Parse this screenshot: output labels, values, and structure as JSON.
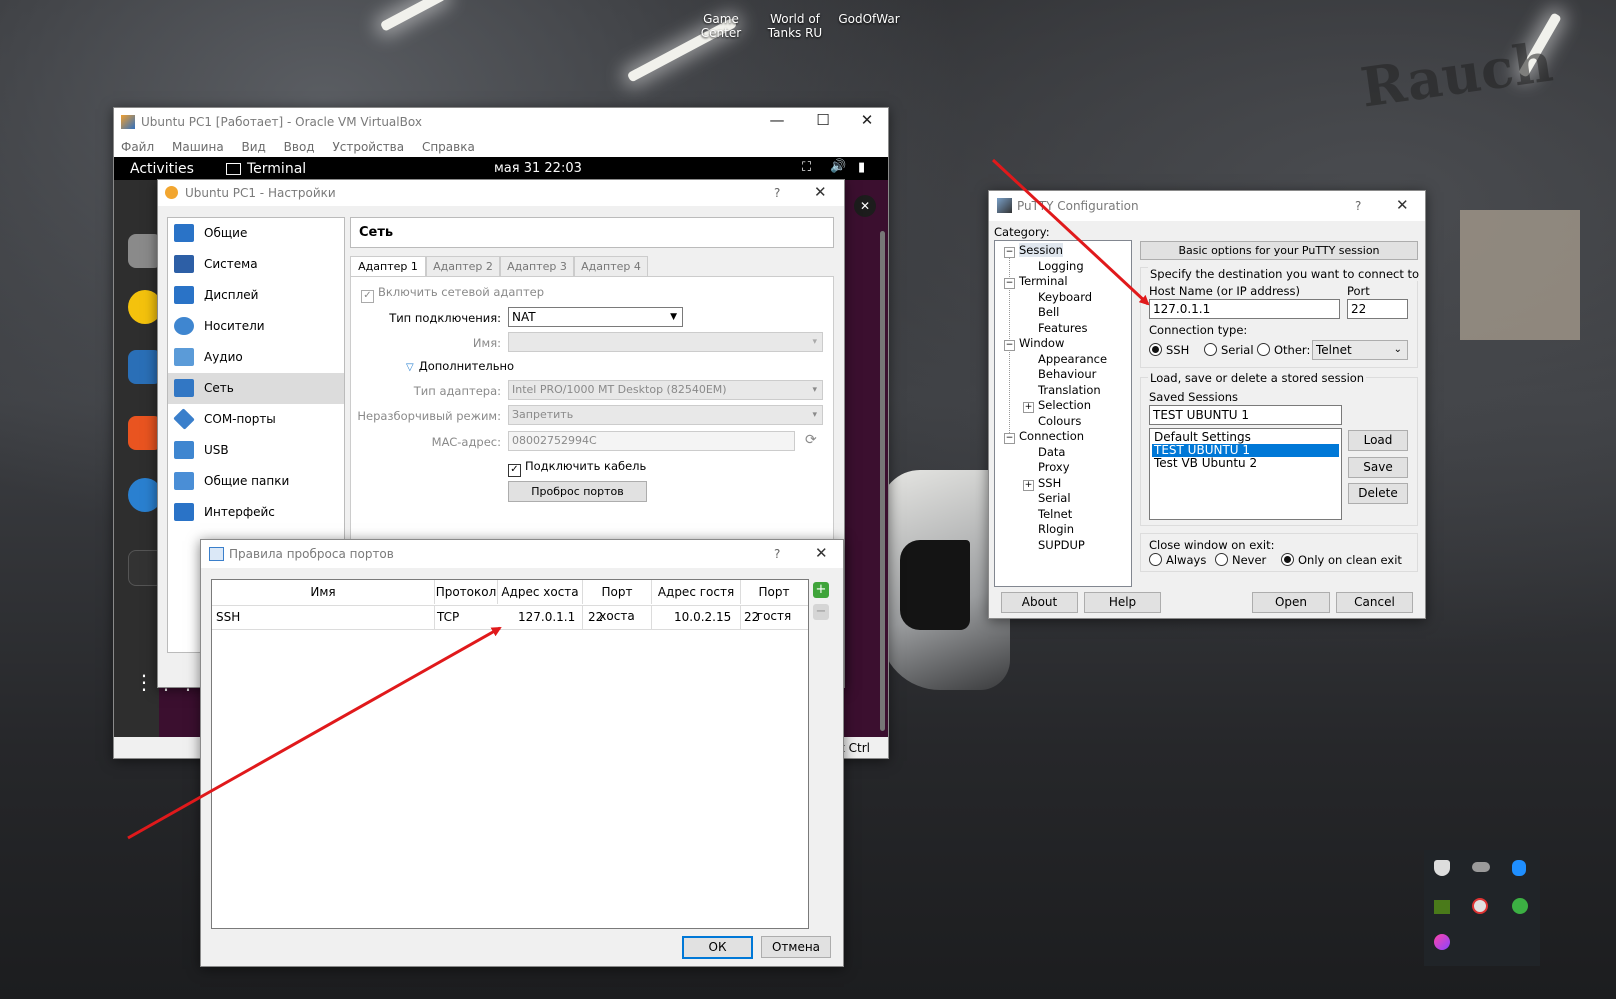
{
  "desktop": {
    "icons": [
      "Game Center",
      "World of",
      "Tanks RU",
      "GodOfWar"
    ]
  },
  "virtualbox": {
    "title": "Ubuntu PC1 [Работает] - Oracle VM VirtualBox",
    "menu": [
      "Файл",
      "Машина",
      "Вид",
      "Ввод",
      "Устройства",
      "Справка"
    ],
    "host_key": "nt Ctrl"
  },
  "ubuntu": {
    "activities": "Activities",
    "app": "Terminal",
    "clock": "мая 31  22:03"
  },
  "settings": {
    "title": "Ubuntu PC1 - Настройки",
    "help": "?",
    "sections": [
      "Общие",
      "Система",
      "Дисплей",
      "Носители",
      "Аудио",
      "Сеть",
      "COM-порты",
      "USB",
      "Общие папки",
      "Интерфейс пользователя"
    ],
    "selected": "Сеть",
    "page_title": "Сеть",
    "tabs": [
      "Адаптер 1",
      "Адаптер 2",
      "Адаптер 3",
      "Адаптер 4"
    ],
    "enable_adapter": "Включить сетевой адаптер",
    "attached_label": "Тип подключения:",
    "attached_value": "NAT",
    "name_label": "Имя:",
    "advanced": "Дополнительно",
    "adapter_type_label": "Тип адаптера:",
    "adapter_type_value": "Intel PRO/1000 MT Desktop (82540EM)",
    "promisc_label": "Неразборчивый режим:",
    "promisc_value": "Запретить",
    "mac_label": "MAC-адрес:",
    "mac_value": "08002752994C",
    "cable": "Подключить кабель",
    "port_forwarding": "Проброс портов"
  },
  "port_rules": {
    "title": "Правила проброса портов",
    "help": "?",
    "columns": [
      "Имя",
      "Протокол",
      "Адрес хоста",
      "Порт хоста",
      "Адрес гостя",
      "Порт гостя"
    ],
    "rows": [
      [
        "SSH",
        "TCP",
        "127.0.1.1",
        "22",
        "10.0.2.15",
        "22"
      ]
    ],
    "ok": "ОК",
    "cancel": "Отмена"
  },
  "putty": {
    "title": "PuTTY Configuration",
    "help": "?",
    "category_label": "Category:",
    "tree": [
      {
        "label": "Session",
        "level": 0,
        "expander": "−"
      },
      {
        "label": "Logging",
        "level": 1
      },
      {
        "label": "Terminal",
        "level": 0,
        "expander": "−"
      },
      {
        "label": "Keyboard",
        "level": 1
      },
      {
        "label": "Bell",
        "level": 1
      },
      {
        "label": "Features",
        "level": 1
      },
      {
        "label": "Window",
        "level": 0,
        "expander": "−"
      },
      {
        "label": "Appearance",
        "level": 1
      },
      {
        "label": "Behaviour",
        "level": 1
      },
      {
        "label": "Translation",
        "level": 1
      },
      {
        "label": "Selection",
        "level": 1,
        "expander": "+"
      },
      {
        "label": "Colours",
        "level": 1
      },
      {
        "label": "Connection",
        "level": 0,
        "expander": "−"
      },
      {
        "label": "Data",
        "level": 1
      },
      {
        "label": "Proxy",
        "level": 1
      },
      {
        "label": "SSH",
        "level": 1,
        "expander": "+"
      },
      {
        "label": "Serial",
        "level": 1
      },
      {
        "label": "Telnet",
        "level": 1
      },
      {
        "label": "Rlogin",
        "level": 1
      },
      {
        "label": "SUPDUP",
        "level": 1
      }
    ],
    "header": "Basic options for your PuTTY session",
    "dest_label": "Specify the destination you want to connect to",
    "host_label": "Host Name (or IP address)",
    "host_value": "127.0.1.1",
    "port_label": "Port",
    "port_value": "22",
    "conn_type_label": "Connection type:",
    "conn_types": [
      "SSH",
      "Serial",
      "Other:"
    ],
    "conn_selected": "SSH",
    "other_value": "Telnet",
    "sessions_group": "Load, save or delete a stored session",
    "saved_label": "Saved Sessions",
    "saved_value": "TEST UBUNTU 1",
    "sessions": [
      "Default Settings",
      "TEST UBUNTU 1",
      "Test VB Ubuntu 2"
    ],
    "selected_session": "TEST UBUNTU 1",
    "load": "Load",
    "save": "Save",
    "delete": "Delete",
    "close_label": "Close window on exit:",
    "close_options": [
      "Always",
      "Never",
      "Only on clean exit"
    ],
    "close_selected": "Only on clean exit",
    "about": "About",
    "help_btn": "Help",
    "open": "Open",
    "cancel": "Cancel"
  },
  "colors": {
    "arrow": "#e0191b",
    "ubuntu_orange": "#e95420",
    "selection": "#0078d7"
  }
}
